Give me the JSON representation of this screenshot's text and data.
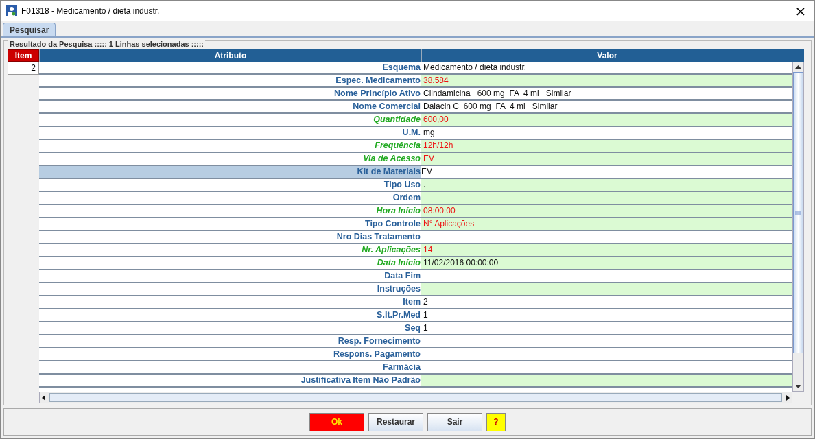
{
  "window": {
    "title": "F01318 - Medicamento / dieta industr.",
    "close": "×"
  },
  "tabs": [
    {
      "label": "Pesquisar",
      "selected": true
    }
  ],
  "group": {
    "title": "Resultado da Pesquisa ::::: 1 Linhas selecionadas :::::"
  },
  "table": {
    "columns": [
      "Item",
      "Atributo",
      "Valor"
    ],
    "item_rows": [
      {
        "value": "2"
      }
    ],
    "rows": [
      {
        "attribute": "Esquema",
        "value": "Medicamento / dieta industr.",
        "required": false,
        "editable": false,
        "alert": false,
        "selected": false
      },
      {
        "attribute": "Espec. Medicamento",
        "value": "38.584",
        "required": false,
        "editable": true,
        "alert": true,
        "selected": false
      },
      {
        "attribute": "Nome Princípio Ativo",
        "value": "Clindamicina   600 mg  FA  4 ml   Similar",
        "required": false,
        "editable": false,
        "alert": false,
        "selected": false
      },
      {
        "attribute": "Nome Comercial",
        "value": "Dalacin C  600 mg  FA  4 ml   Similar",
        "required": false,
        "editable": false,
        "alert": false,
        "selected": false
      },
      {
        "attribute": "Quantidade",
        "value": "600,00",
        "required": true,
        "editable": true,
        "alert": true,
        "selected": false
      },
      {
        "attribute": "U.M.",
        "value": "mg",
        "required": false,
        "editable": false,
        "alert": false,
        "selected": false
      },
      {
        "attribute": "Frequência",
        "value": "12h/12h",
        "required": true,
        "editable": true,
        "alert": true,
        "selected": false
      },
      {
        "attribute": "Via de Acesso",
        "value": "EV",
        "required": true,
        "editable": true,
        "alert": true,
        "selected": false
      },
      {
        "attribute": "Kit de Materiais",
        "value": "EV",
        "required": false,
        "editable": false,
        "alert": false,
        "selected": true
      },
      {
        "attribute": "Tipo Uso",
        "value": ".",
        "required": false,
        "editable": true,
        "alert": false,
        "selected": false
      },
      {
        "attribute": "Ordem",
        "required": false,
        "editable": true,
        "selected": false
      },
      {
        "attribute": "Hora Início",
        "value": "08:00:00",
        "required": true,
        "editable": true,
        "alert": true,
        "selected": false
      },
      {
        "attribute": "Tipo Controle",
        "value": "N° Aplicações",
        "required": false,
        "editable": true,
        "alert": true,
        "selected": false
      },
      {
        "attribute": "Nro Dias Tratamento",
        "required": false,
        "editable": false,
        "selected": false
      },
      {
        "attribute": "Nr. Aplicações",
        "value": "14",
        "required": true,
        "editable": true,
        "alert": true,
        "selected": false
      },
      {
        "attribute": "Data Início",
        "value": "11/02/2016 00:00:00",
        "required": true,
        "editable": true,
        "alert": false,
        "selected": false
      },
      {
        "attribute": "Data Fim",
        "required": false,
        "editable": false,
        "selected": false
      },
      {
        "attribute": "Instruções",
        "required": false,
        "editable": true,
        "selected": false
      },
      {
        "attribute": "Item",
        "value": "2",
        "required": false,
        "editable": false,
        "alert": false,
        "selected": false
      },
      {
        "attribute": "S.It.Pr.Med",
        "value": "1",
        "required": false,
        "editable": false,
        "alert": false,
        "selected": false
      },
      {
        "attribute": "Seq",
        "value": "1",
        "required": false,
        "editable": false,
        "alert": false,
        "selected": false
      },
      {
        "attribute": "Resp. Fornecimento",
        "required": false,
        "editable": false,
        "selected": false
      },
      {
        "attribute": "Respons. Pagamento",
        "required": false,
        "editable": false,
        "selected": false
      },
      {
        "attribute": "Farmácia",
        "required": false,
        "editable": false,
        "selected": false
      },
      {
        "attribute": "Justificativa Item Não Padrão",
        "required": false,
        "editable": true,
        "selected": false
      }
    ]
  },
  "buttons": [
    {
      "label": "Ok",
      "kind": "primary"
    },
    {
      "label": "Restaurar",
      "kind": "normal"
    },
    {
      "label": "Sair",
      "kind": "normal"
    },
    {
      "label": "?",
      "kind": "help"
    }
  ]
}
